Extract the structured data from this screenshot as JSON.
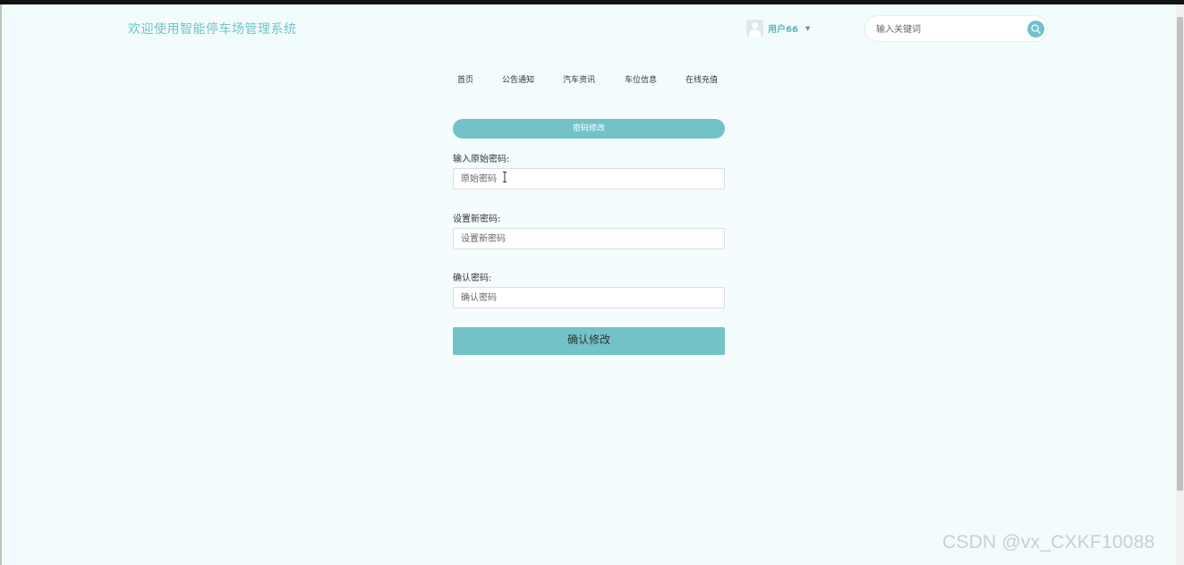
{
  "header": {
    "site_title": "欢迎使用智能停车场管理系统",
    "username": "用户66",
    "search_placeholder": "输入关键词"
  },
  "nav": {
    "items": [
      "首页",
      "公告通知",
      "汽车资讯",
      "车位信息",
      "在线充值"
    ]
  },
  "form": {
    "title": "密码修改",
    "original_password": {
      "label": "输入原始密码:",
      "placeholder": "原始密码"
    },
    "new_password": {
      "label": "设置新密码:",
      "placeholder": "设置新密码"
    },
    "confirm_password": {
      "label": "确认密码:",
      "placeholder": "确认密码"
    },
    "submit_label": "确认修改"
  },
  "watermark": "CSDN @vx_CXKF10088",
  "colors": {
    "accent": "#72c2c8",
    "background": "#f3fcfd"
  },
  "icons": {
    "search": "search-icon",
    "avatar": "user-avatar-icon",
    "dropdown": "caret-down-icon"
  }
}
